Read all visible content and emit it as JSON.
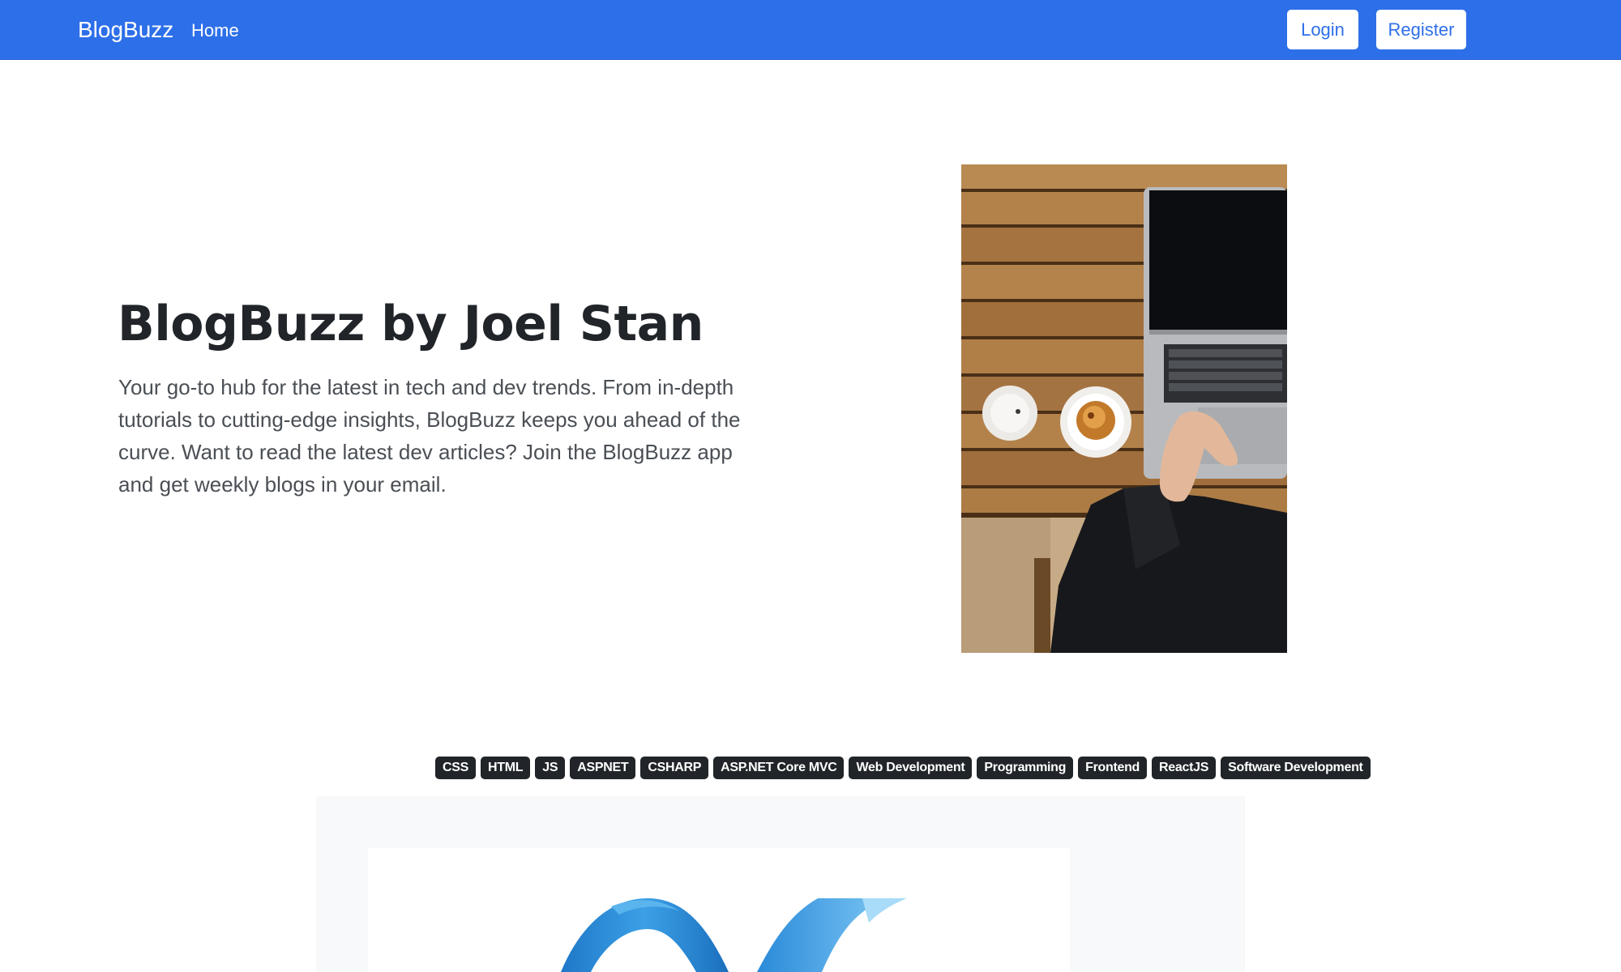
{
  "navbar": {
    "brand": "BlogBuzz",
    "links": [
      {
        "label": "Home"
      }
    ],
    "buttons": {
      "login": "Login",
      "register": "Register"
    },
    "background_color": "#2d6fe9"
  },
  "hero": {
    "title": "BlogBuzz by Joel Stan",
    "lead": "Your go-to hub for the latest in tech and dev trends. From in-depth tutorials to cutting-edge insights, BlogBuzz keeps you ahead of the curve. Want to read the latest dev articles? Join the BlogBuzz app and get weekly blogs in your email."
  },
  "tags": [
    {
      "label": "CSS"
    },
    {
      "label": "HTML"
    },
    {
      "label": "JS"
    },
    {
      "label": "ASPNET"
    },
    {
      "label": "CSHARP"
    },
    {
      "label": "ASP.NET Core MVC"
    },
    {
      "label": "Web Development"
    },
    {
      "label": "Programming"
    },
    {
      "label": "Frontend"
    },
    {
      "label": "ReactJS"
    },
    {
      "label": "Software Development"
    }
  ],
  "colors": {
    "primary": "#2d6fe9",
    "tag_background": "#212529",
    "section_background": "#f8f9fa"
  }
}
